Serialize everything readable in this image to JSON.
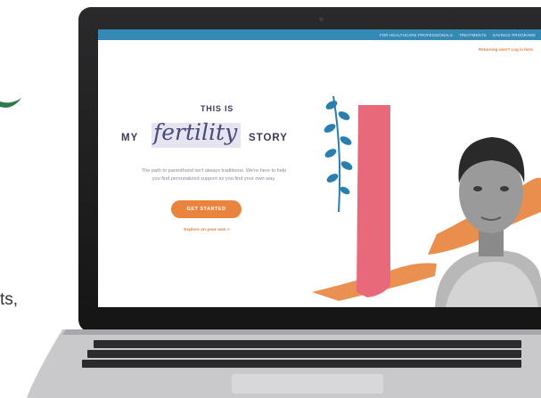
{
  "background": {
    "side_text": "ts,",
    "accent_color": "#2f7a4a"
  },
  "navbar": {
    "links": [
      {
        "label": "FOR HEALTHCARE PROFESSIONALS"
      },
      {
        "label": "TREATMENTS"
      },
      {
        "label": "SAVINGS PROGRAMS"
      }
    ],
    "color": "#3489b5"
  },
  "header": {
    "returning_user": "Returning User? Log in here."
  },
  "hero": {
    "eyebrow": "THIS IS",
    "headline_left": "MY",
    "headline_script": "fertility",
    "headline_right": "STORY",
    "subtext_line1": "The path to parenthood isn't always traditional. We're here to help",
    "subtext_line2": "you find personalized support as you find your own way.",
    "cta_label": "GET STARTED",
    "explore_link": "Explore on your own >"
  },
  "colors": {
    "brand_orange": "#e8843e",
    "brand_blue": "#3489b5",
    "pink": "#e86a7a",
    "leaf_blue": "#2b7fae",
    "text_navy": "#3a3a5a"
  },
  "icons": {
    "leaf": "leaf-sprig-icon",
    "camera": "camera-dot"
  }
}
